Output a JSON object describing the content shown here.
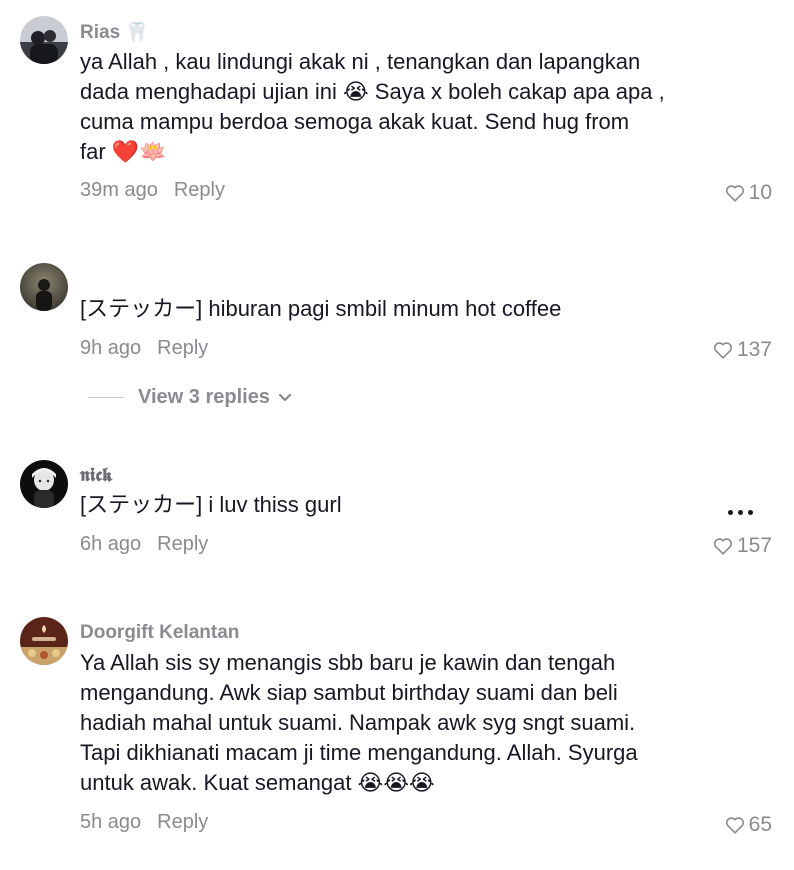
{
  "comments": [
    {
      "username": "Rias 🦷",
      "text": "ya Allah , kau lindungi akak ni , tenangkan dan lapangkan\ndada menghadapi ujian ini 😭 Saya x boleh cakap apa apa ,\ncuma mampu berdoa semoga akak kuat. Send hug from\nfar ❤️🪷",
      "time": "39m ago",
      "reply_label": "Reply",
      "likes": "10"
    },
    {
      "username": "",
      "text": "[ステッカー] hiburan pagi smbil minum hot coffee",
      "time": "9h ago",
      "reply_label": "Reply",
      "likes": "137",
      "view_replies": "View 3 replies"
    },
    {
      "username": "𝖓𝖎𝖈𝖐",
      "text": "[ステッカー] i luv thiss gurl",
      "time": "6h ago",
      "reply_label": "Reply",
      "likes": "157"
    },
    {
      "username": "Doorgift Kelantan",
      "text": "Ya Allah sis sy menangis sbb baru je kawin dan tengah\nmengandung. Awk siap sambut birthday suami dan beli\nhadiah mahal untuk suami. Nampak awk syg sngt suami.\nTapi dikhianati macam ji time mengandung. Allah. Syurga\nuntuk awak. Kuat semangat 😭😭😭",
      "time": "5h ago",
      "reply_label": "Reply",
      "likes": "65"
    }
  ],
  "icons": {
    "like": "heart-outline-icon",
    "more": "more-horizontal-icon",
    "expand": "chevron-down-icon"
  },
  "colors": {
    "text": "#161823",
    "muted": "#8a8b91"
  }
}
